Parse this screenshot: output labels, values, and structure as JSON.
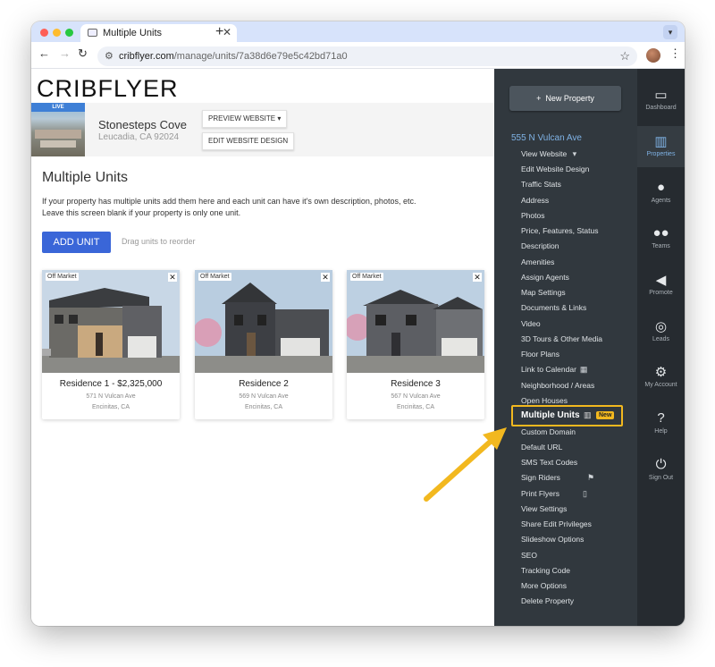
{
  "browser": {
    "tab_title": "Multiple Units",
    "url_host": "cribflyer.com",
    "url_path": "/manage/units/7a38d6e79e5c42bd71a0"
  },
  "header": {
    "logo_text": "CRIBFLYER",
    "live_badge": "LIVE",
    "property_name": "Stonesteps Cove",
    "property_address": "Leucadia, CA 92024",
    "preview_button": "PREVIEW WEBSITE",
    "edit_design_button": "EDIT WEBSITE DESIGN"
  },
  "main": {
    "title": "Multiple Units",
    "description_line1": "If your property has multiple units add them here and each unit can have it's own description, photos, etc.",
    "description_line2": "Leave this screen blank if your property is only one unit.",
    "add_unit_label": "ADD UNIT",
    "drag_hint": "Drag units to reorder",
    "units": [
      {
        "badge": "Off Market",
        "title": "Residence 1 - $2,325,000",
        "street": "571 N Vulcan Ave",
        "city": "Encinitas, CA"
      },
      {
        "badge": "Off Market",
        "title": "Residence 2",
        "street": "569 N Vulcan Ave",
        "city": "Encinitas, CA"
      },
      {
        "badge": "Off Market",
        "title": "Residence 3",
        "street": "567 N Vulcan Ave",
        "city": "Encinitas, CA"
      }
    ]
  },
  "sidebar": {
    "new_property_label": "New Property",
    "property_heading": "555 N Vulcan Ave",
    "items": [
      "View Website",
      "Edit Website Design",
      "Traffic Stats",
      "Address",
      "Photos",
      "Price, Features, Status",
      "Description",
      "Amenities",
      "Assign Agents",
      "Map Settings",
      "Documents & Links",
      "Video",
      "3D Tours & Other Media",
      "Floor Plans",
      "Link to Calendar",
      "Neighborhood / Areas",
      "Open Houses",
      "Multiple Units",
      "Custom Domain",
      "Default URL",
      "SMS Text Codes",
      "Sign Riders",
      "Print Flyers",
      "View Settings",
      "Share Edit Privileges",
      "Slideshow Options",
      "SEO",
      "Tracking Code",
      "More Options",
      "Delete Property"
    ],
    "new_badge": "New"
  },
  "rail": {
    "items": [
      "Dashboard",
      "Properties",
      "Agents",
      "Teams",
      "Promote",
      "Leads",
      "My Account",
      "Help",
      "Sign Out"
    ]
  },
  "colors": {
    "accent_blue": "#3a66d8",
    "highlight_yellow": "#f2b81f",
    "sidebar_bg": "#31383e",
    "rail_bg": "#262b30",
    "link_blue": "#7fb2e5"
  }
}
